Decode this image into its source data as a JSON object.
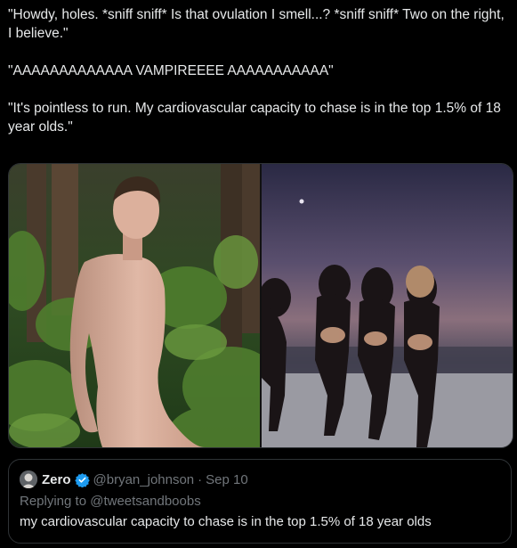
{
  "tweet": {
    "paragraphs": [
      "\"Howdy, holes. *sniff sniff* Is that ovulation I smell...? *sniff sniff* Two on the right, I believe.\"",
      "\"AAAAAAAAAAAAA VAMPIREEEE AAAAAAAAAAA\"",
      "\"It's pointless to run. My cardiovascular capacity to chase is in the top 1.5% of 18 year olds.\""
    ]
  },
  "media": {
    "images": [
      {
        "name": "shirtless-man-in-ferns-photo"
      },
      {
        "name": "women-running-on-beach-at-dusk-photo"
      }
    ]
  },
  "quote": {
    "name": "Zero",
    "handle": "@bryan_johnson",
    "dot": "·",
    "date": "Sep 10",
    "replying_prefix": "Replying to",
    "replying_handle": "@tweetsandboobs",
    "text": "my cardiovascular capacity to chase is in the top 1.5% of 18 year olds",
    "badge_color": "#1d9bf0"
  },
  "colors": {
    "background": "#000000",
    "text": "#e7e9ea",
    "secondary": "#71767b",
    "border": "#2f3336"
  }
}
